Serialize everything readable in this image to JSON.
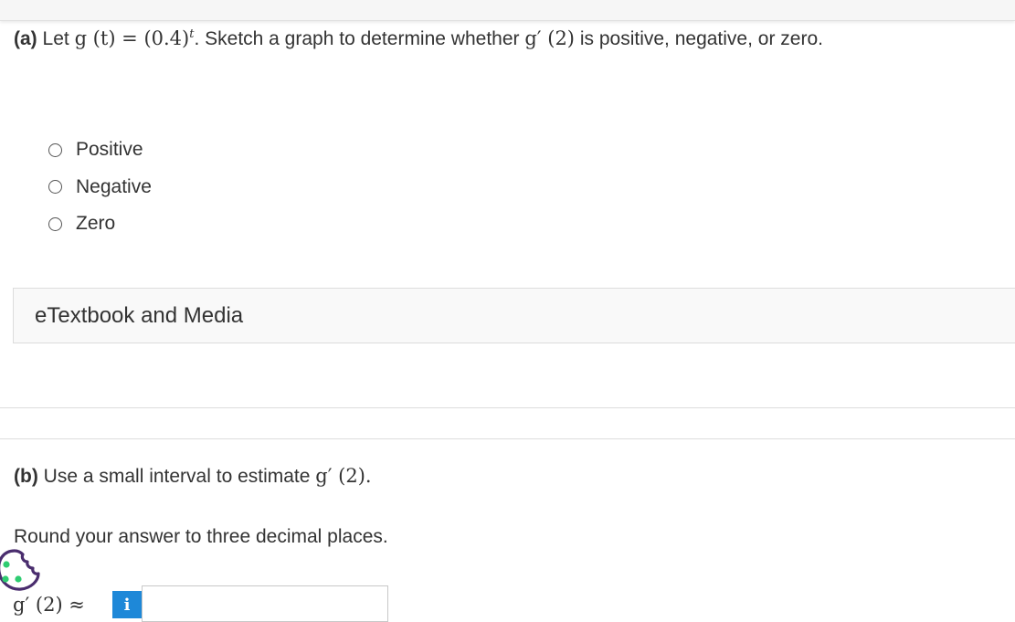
{
  "part_a": {
    "label": "(a)",
    "text_let": "Let",
    "func_def": "g (t)  =  (0.4)",
    "func_exp": "t",
    "text_mid": ". Sketch a graph to determine whether",
    "deriv_expr": "g′ (2)",
    "text_end": "is positive, negative, or zero."
  },
  "options": [
    "Positive",
    "Negative",
    "Zero"
  ],
  "etextbook": {
    "label": "eTextbook and Media"
  },
  "part_b": {
    "label": "(b)",
    "text": "Use a small interval to estimate",
    "deriv_expr": "g′ (2).",
    "round_instruction": "Round your answer to three decimal places.",
    "answer_label": "g′ (2)  ≈",
    "info_icon": "i",
    "answer_value": ""
  },
  "colors": {
    "info_button": "#1e88d8",
    "cookie_icon": "#4a2d6e",
    "cookie_dots": "#2ecc71"
  }
}
